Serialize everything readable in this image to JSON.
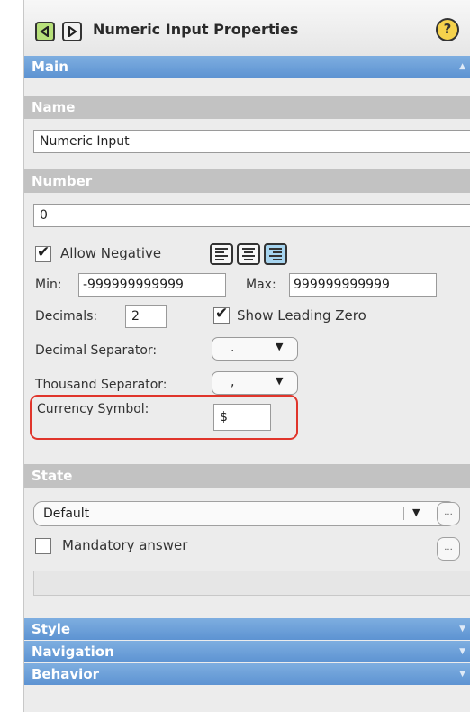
{
  "title": "Numeric Input Properties",
  "help_glyph": "?",
  "sections": {
    "main": "Main",
    "style": "Style",
    "navigation": "Navigation",
    "behavior": "Behavior"
  },
  "name_group": {
    "heading": "Name",
    "value": "Numeric Input"
  },
  "number_group": {
    "heading": "Number",
    "value": "0",
    "allow_negative": {
      "label": "Allow Negative",
      "checked": true
    },
    "min": {
      "label": "Min:",
      "value": "-999999999999"
    },
    "max": {
      "label": "Max:",
      "value": "999999999999"
    },
    "decimals": {
      "label": "Decimals:",
      "value": "2"
    },
    "show_leading_zero": {
      "label": "Show Leading Zero",
      "checked": true
    },
    "decimal_separator": {
      "label": "Decimal Separator:",
      "value": "."
    },
    "thousand_separator": {
      "label": "Thousand Separator:",
      "value": ","
    },
    "currency_symbol": {
      "label": "Currency Symbol:",
      "value": "$"
    }
  },
  "state_group": {
    "heading": "State",
    "dropdown_value": "Default",
    "mandatory": {
      "label": "Mandatory answer",
      "checked": false
    },
    "more": "..."
  },
  "icons": {
    "check": "✔",
    "caret": "▼"
  },
  "colors": {
    "section_bar": "#5d93d2",
    "group_head": "#c2c2c2",
    "highlight": "#e0352b",
    "help": "#f5d24c"
  }
}
